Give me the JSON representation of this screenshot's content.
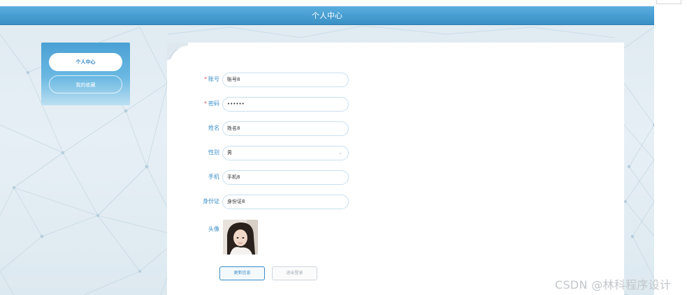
{
  "header": {
    "title": "个人中心"
  },
  "sidebar": {
    "items": [
      {
        "label": "个人中心",
        "active": true
      },
      {
        "label": "我的收藏",
        "active": false
      }
    ]
  },
  "form": {
    "fields": [
      {
        "label": "账号",
        "required": true,
        "value": "账号8",
        "type": "text"
      },
      {
        "label": "密码",
        "required": true,
        "value": "••••••",
        "type": "password"
      },
      {
        "label": "姓名",
        "required": false,
        "value": "姓名8",
        "type": "text"
      },
      {
        "label": "性别",
        "required": false,
        "value": "男",
        "type": "select"
      },
      {
        "label": "手机",
        "required": false,
        "value": "手机8",
        "type": "text"
      },
      {
        "label": "身份证",
        "required": false,
        "value": "身份证8",
        "type": "text"
      }
    ],
    "avatar_label": "头像",
    "required_mark": "*",
    "update_button": "更新信息",
    "logout_button": "退出登录"
  },
  "watermark": "CSDN @林科程序设计",
  "colors": {
    "accent": "#3b8ec9",
    "header": "#4a9fd3",
    "required": "#e05454"
  },
  "icons": {
    "select_arrow": "chevron-down-icon"
  }
}
